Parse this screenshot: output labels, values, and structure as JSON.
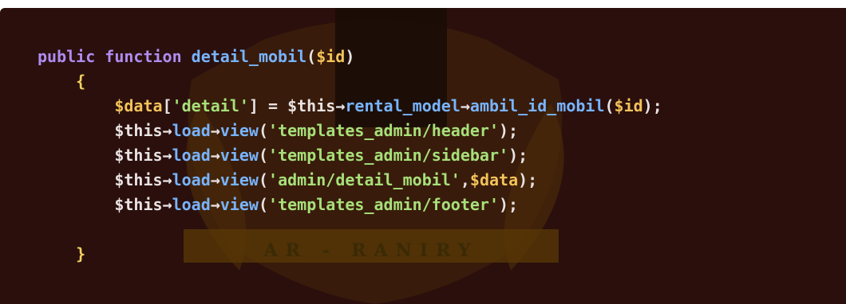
{
  "code": {
    "lines": [
      [
        [
          "kw",
          "public"
        ],
        [
          "pl",
          " "
        ],
        [
          "kw",
          "function"
        ],
        [
          "pl",
          " "
        ],
        [
          "fn",
          "detail_mobil"
        ],
        [
          "pl",
          "("
        ],
        [
          "var",
          "$id"
        ],
        [
          "pl",
          ")"
        ]
      ],
      [
        [
          "pl",
          "    "
        ],
        [
          "br",
          "{"
        ]
      ],
      [
        [
          "pl",
          "        "
        ],
        [
          "var",
          "$data"
        ],
        [
          "pl",
          "["
        ],
        [
          "str",
          "'detail'"
        ],
        [
          "pl",
          "] = "
        ],
        [
          "pl",
          "$this"
        ],
        [
          "pl",
          "→"
        ],
        [
          "fn",
          "rental_model"
        ],
        [
          "pl",
          "→"
        ],
        [
          "fn",
          "ambil_id_mobil"
        ],
        [
          "pl",
          "("
        ],
        [
          "var",
          "$id"
        ],
        [
          "pl",
          ");"
        ]
      ],
      [
        [
          "pl",
          "        "
        ],
        [
          "pl",
          "$this"
        ],
        [
          "pl",
          "→"
        ],
        [
          "fn",
          "load"
        ],
        [
          "pl",
          "→"
        ],
        [
          "fn",
          "view"
        ],
        [
          "pl",
          "("
        ],
        [
          "str",
          "'templates_admin/header'"
        ],
        [
          "pl",
          ");"
        ]
      ],
      [
        [
          "pl",
          "        "
        ],
        [
          "pl",
          "$this"
        ],
        [
          "pl",
          "→"
        ],
        [
          "fn",
          "load"
        ],
        [
          "pl",
          "→"
        ],
        [
          "fn",
          "view"
        ],
        [
          "pl",
          "("
        ],
        [
          "str",
          "'templates_admin/sidebar'"
        ],
        [
          "pl",
          ");"
        ]
      ],
      [
        [
          "pl",
          "        "
        ],
        [
          "pl",
          "$this"
        ],
        [
          "pl",
          "→"
        ],
        [
          "fn",
          "load"
        ],
        [
          "pl",
          "→"
        ],
        [
          "fn",
          "view"
        ],
        [
          "pl",
          "("
        ],
        [
          "str",
          "'admin/detail_mobil'"
        ],
        [
          "pl",
          ","
        ],
        [
          "var",
          "$data"
        ],
        [
          "pl",
          ");"
        ]
      ],
      [
        [
          "pl",
          "        "
        ],
        [
          "pl",
          "$this"
        ],
        [
          "pl",
          "→"
        ],
        [
          "fn",
          "load"
        ],
        [
          "pl",
          "→"
        ],
        [
          "fn",
          "view"
        ],
        [
          "pl",
          "("
        ],
        [
          "str",
          "'templates_admin/footer'"
        ],
        [
          "pl",
          ");"
        ]
      ],
      [
        [
          "pl",
          ""
        ]
      ],
      [
        [
          "pl",
          "    "
        ],
        [
          "br",
          "}"
        ]
      ]
    ]
  },
  "watermark": {
    "text": "AR - RANIRY"
  },
  "colors": {
    "background": "#2a0f0d",
    "keyword": "#b08cf0",
    "function": "#78b4ff",
    "variable": "#f3c35a",
    "string": "#a7e07a"
  }
}
